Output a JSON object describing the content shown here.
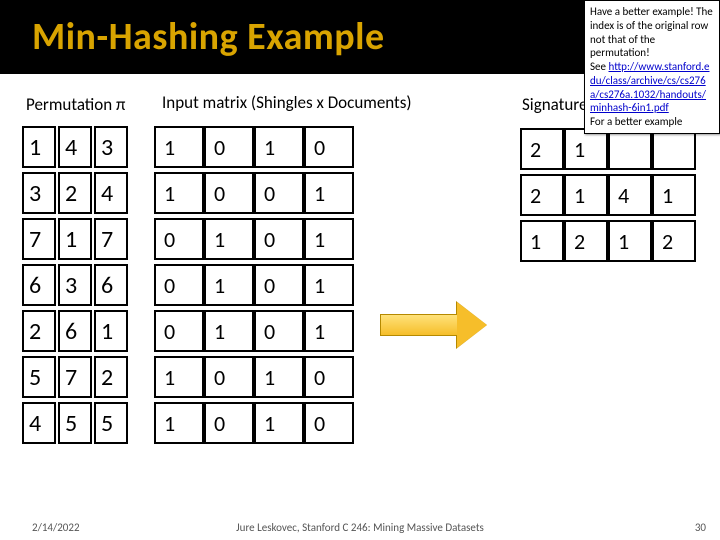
{
  "title": "Min-Hashing Example",
  "labels": {
    "permutation": "Permutation π",
    "input": "Input matrix (Shingles x Documents)",
    "signature": "Signature m"
  },
  "permutation_cols": [
    [
      1,
      3,
      7,
      6,
      2,
      5,
      4
    ],
    [
      4,
      2,
      1,
      3,
      6,
      7,
      5
    ],
    [
      3,
      4,
      7,
      6,
      1,
      2,
      5
    ]
  ],
  "input_matrix": [
    [
      1,
      0,
      1,
      0
    ],
    [
      1,
      0,
      0,
      1
    ],
    [
      0,
      1,
      0,
      1
    ],
    [
      0,
      1,
      0,
      1
    ],
    [
      0,
      1,
      0,
      1
    ],
    [
      1,
      0,
      1,
      0
    ],
    [
      1,
      0,
      1,
      0
    ]
  ],
  "signature_matrix": [
    [
      2,
      1,
      null,
      null
    ],
    [
      2,
      1,
      4,
      1
    ],
    [
      1,
      2,
      1,
      2
    ]
  ],
  "note": {
    "line1": "Have a better example! The index is of the original row not that of the permutation!",
    "line2": "See",
    "url": "http://www.stanford.edu/class/archive/cs/cs276a/cs276a.1032/handouts/minhash-6in1.pdf",
    "line3": "For a better example"
  },
  "footer": {
    "date": "2/14/2022",
    "credit": "Jure Leskovec, Stanford C 246: Mining Massive Datasets",
    "page": "30"
  }
}
